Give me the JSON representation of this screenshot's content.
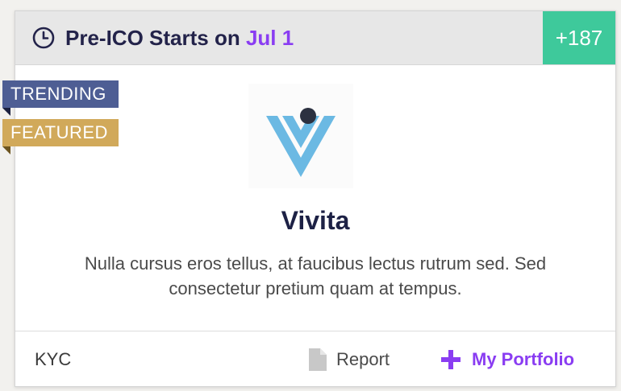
{
  "header": {
    "title_prefix": "Pre-ICO Starts on",
    "title_date": "Jul 1",
    "count_badge": "+187"
  },
  "ribbons": {
    "trending": "TRENDING",
    "featured": "FEATURED"
  },
  "project": {
    "name": "Vivita",
    "description": "Nulla cursus eros tellus, at faucibus lectus rutrum sed. Sed consectetur pretium quam at tempus.",
    "logo_icon": "vivita-logo"
  },
  "footer": {
    "kyc_label": "KYC",
    "report_label": "Report",
    "report_icon": "document-icon",
    "portfolio_label": "My Portfolio",
    "portfolio_icon": "plus-icon"
  },
  "colors": {
    "accent_purple": "#8a3df2",
    "badge_green": "#3ec99b",
    "trending_ribbon": "#4e5e94",
    "featured_ribbon": "#d1a95a",
    "title_navy": "#23234a",
    "logo_blue": "#6bb9e3",
    "logo_dot": "#2c3140"
  }
}
